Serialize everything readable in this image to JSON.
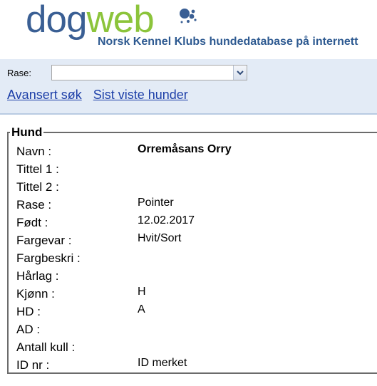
{
  "brand": {
    "logo_part1": "dog",
    "logo_part2": "web",
    "tagline": "Norsk Kennel Klubs hundedatabase på internett",
    "colors": {
      "dog": "#3a5f94",
      "web": "#8cc43b",
      "tagline": "#2e5a91"
    }
  },
  "search": {
    "rase_label": "Rase:",
    "rase_value": "",
    "dropdown_icon": "chevron-down-icon"
  },
  "links": {
    "advanced": "Avansert søk",
    "recent": "Sist viste hunder"
  },
  "dog": {
    "legend": "Hund",
    "fields": [
      {
        "label": "Navn :",
        "value": "Orremåsans Orry"
      },
      {
        "label": "Tittel 1 :",
        "value": ""
      },
      {
        "label": "Tittel 2 :",
        "value": ""
      },
      {
        "label": "Rase :",
        "value": "Pointer"
      },
      {
        "label": "Født :",
        "value": "12.02.2017"
      },
      {
        "label": "Fargevar :",
        "value": "Hvit/Sort"
      },
      {
        "label": "Fargbeskri :",
        "value": ""
      },
      {
        "label": "Hårlag :",
        "value": ""
      },
      {
        "label": "Kjønn :",
        "value": "H"
      },
      {
        "label": "HD :",
        "value": "A"
      },
      {
        "label": "AD :",
        "value": ""
      },
      {
        "label": "Antall kull :",
        "value": ""
      },
      {
        "label": "ID nr :",
        "value": "ID merket"
      }
    ]
  }
}
